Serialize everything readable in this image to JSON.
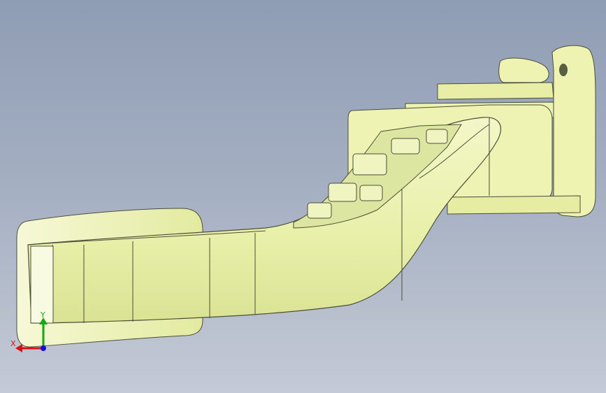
{
  "viewport": {
    "background_top": "#8f9db4",
    "background_bottom": "#c4cad6",
    "part_color": "#eef3b2",
    "edge_color": "#4a4f36"
  },
  "triad": {
    "x_label": "X",
    "y_label": "Y",
    "x_color": "#dd1111",
    "y_color": "#11aa11",
    "z_color": "#1111dd"
  }
}
